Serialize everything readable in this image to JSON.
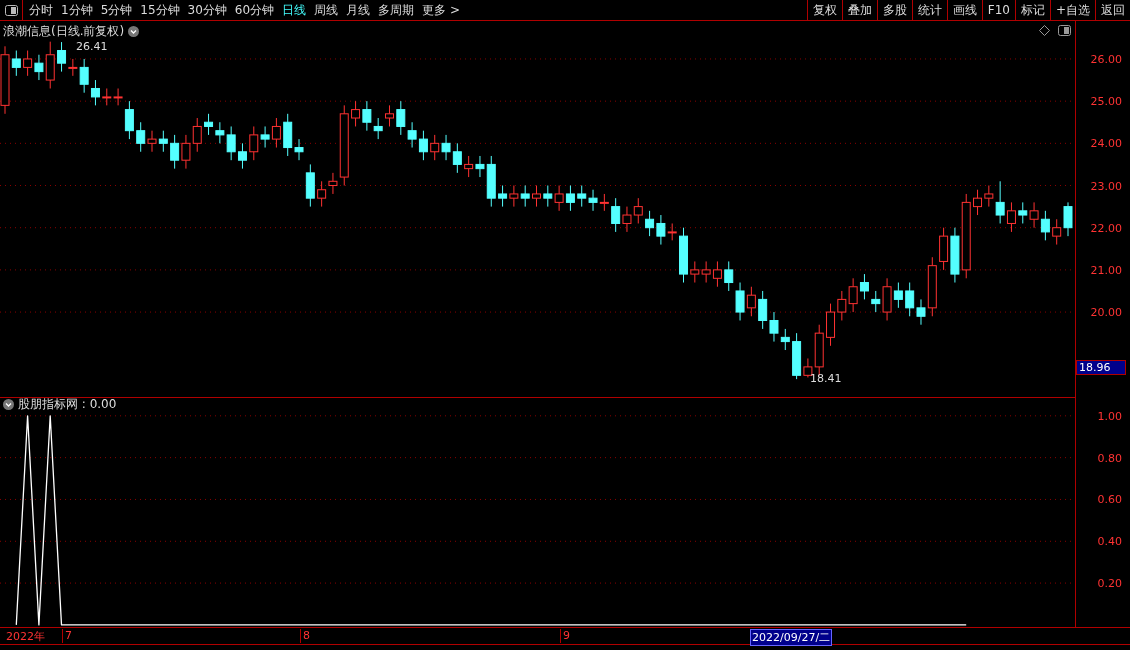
{
  "toolbar": {
    "periods": [
      {
        "label": "分时",
        "selected": false
      },
      {
        "label": "1分钟",
        "selected": false
      },
      {
        "label": "5分钟",
        "selected": false
      },
      {
        "label": "15分钟",
        "selected": false
      },
      {
        "label": "30分钟",
        "selected": false
      },
      {
        "label": "60分钟",
        "selected": false
      },
      {
        "label": "日线",
        "selected": true
      },
      {
        "label": "周线",
        "selected": false
      },
      {
        "label": "月线",
        "selected": false
      },
      {
        "label": "多周期",
        "selected": false
      },
      {
        "label": "更多 >",
        "selected": false
      }
    ],
    "actions": [
      "复权",
      "叠加",
      "多股",
      "统计",
      "画线",
      "F10",
      "标记",
      "+自选",
      "返回"
    ]
  },
  "price_panel": {
    "title": "浪潮信息(日线.前复权)",
    "high_label": "26.41",
    "low_label": "18.41",
    "current_price": "18.96",
    "chart_data": {
      "type": "candlestick",
      "ylim": [
        18.01,
        26.9
      ],
      "grid": true,
      "yticks": [
        {
          "value": 26,
          "label": "26.00"
        },
        {
          "value": 25,
          "label": "25.00"
        },
        {
          "value": 24,
          "label": "24.00"
        },
        {
          "value": 23,
          "label": "23.00"
        },
        {
          "value": 22,
          "label": "22.00"
        },
        {
          "value": 21,
          "label": "21.00"
        },
        {
          "value": 20,
          "label": "20.00"
        }
      ],
      "ohlc": [
        [
          24.9,
          26.3,
          24.7,
          26.1
        ],
        [
          26,
          26.2,
          25.6,
          25.8
        ],
        [
          25.8,
          26.2,
          25.6,
          26
        ],
        [
          25.9,
          26.1,
          25.5,
          25.7
        ],
        [
          25.5,
          26.41,
          25.3,
          26.1
        ],
        [
          26.2,
          26.4,
          25.7,
          25.9
        ],
        [
          25.8,
          26,
          25.6,
          25.8
        ],
        [
          25.8,
          26,
          25.2,
          25.4
        ],
        [
          25.3,
          25.5,
          24.9,
          25.1
        ],
        [
          25.1,
          25.3,
          24.9,
          25.1
        ],
        [
          25.1,
          25.3,
          24.9,
          25.1
        ],
        [
          24.8,
          25,
          24.1,
          24.3
        ],
        [
          24.3,
          24.5,
          23.8,
          24
        ],
        [
          24,
          24.3,
          23.8,
          24.1
        ],
        [
          24.1,
          24.3,
          23.8,
          24
        ],
        [
          24,
          24.2,
          23.4,
          23.6
        ],
        [
          23.6,
          24.2,
          23.4,
          24
        ],
        [
          24,
          24.6,
          23.8,
          24.4
        ],
        [
          24.5,
          24.7,
          24.2,
          24.4
        ],
        [
          24.3,
          24.5,
          24,
          24.2
        ],
        [
          24.2,
          24.4,
          23.6,
          23.8
        ],
        [
          23.8,
          24,
          23.4,
          23.6
        ],
        [
          23.8,
          24.4,
          23.6,
          24.2
        ],
        [
          24.2,
          24.4,
          23.9,
          24.1
        ],
        [
          24.1,
          24.6,
          23.9,
          24.4
        ],
        [
          24.5,
          24.7,
          23.7,
          23.9
        ],
        [
          23.9,
          24.1,
          23.6,
          23.8
        ],
        [
          23.3,
          23.5,
          22.5,
          22.7
        ],
        [
          22.7,
          23.1,
          22.5,
          22.9
        ],
        [
          23,
          23.3,
          22.8,
          23.1
        ],
        [
          23.2,
          24.9,
          23,
          24.7
        ],
        [
          24.6,
          25,
          24.4,
          24.8
        ],
        [
          24.8,
          25,
          24.3,
          24.5
        ],
        [
          24.4,
          24.6,
          24.1,
          24.3
        ],
        [
          24.6,
          24.9,
          24.4,
          24.7
        ],
        [
          24.8,
          25,
          24.2,
          24.4
        ],
        [
          24.3,
          24.5,
          23.9,
          24.1
        ],
        [
          24.1,
          24.3,
          23.6,
          23.8
        ],
        [
          23.8,
          24.2,
          23.6,
          24
        ],
        [
          24,
          24.2,
          23.6,
          23.8
        ],
        [
          23.8,
          24,
          23.3,
          23.5
        ],
        [
          23.4,
          23.7,
          23.2,
          23.5
        ],
        [
          23.5,
          23.7,
          23.2,
          23.4
        ],
        [
          23.5,
          23.7,
          22.5,
          22.7
        ],
        [
          22.8,
          23,
          22.5,
          22.7
        ],
        [
          22.7,
          23,
          22.5,
          22.8
        ],
        [
          22.8,
          23,
          22.5,
          22.7
        ],
        [
          22.7,
          23,
          22.5,
          22.8
        ],
        [
          22.8,
          23,
          22.5,
          22.7
        ],
        [
          22.6,
          23,
          22.4,
          22.8
        ],
        [
          22.8,
          23,
          22.4,
          22.6
        ],
        [
          22.8,
          23,
          22.5,
          22.7
        ],
        [
          22.7,
          22.9,
          22.4,
          22.6
        ],
        [
          22.6,
          22.8,
          22.4,
          22.6
        ],
        [
          22.5,
          22.7,
          21.9,
          22.1
        ],
        [
          22.1,
          22.5,
          21.9,
          22.3
        ],
        [
          22.3,
          22.7,
          22.1,
          22.5
        ],
        [
          22.2,
          22.4,
          21.8,
          22
        ],
        [
          22.1,
          22.3,
          21.6,
          21.8
        ],
        [
          21.9,
          22.1,
          21.7,
          21.9
        ],
        [
          21.8,
          22,
          20.7,
          20.9
        ],
        [
          20.9,
          21.2,
          20.7,
          21
        ],
        [
          20.9,
          21.2,
          20.7,
          21
        ],
        [
          20.8,
          21.2,
          20.6,
          21
        ],
        [
          21,
          21.2,
          20.5,
          20.7
        ],
        [
          20.5,
          20.7,
          19.8,
          20
        ],
        [
          20.1,
          20.6,
          19.9,
          20.4
        ],
        [
          20.3,
          20.5,
          19.6,
          19.8
        ],
        [
          19.8,
          20,
          19.3,
          19.5
        ],
        [
          19.4,
          19.6,
          19.1,
          19.3
        ],
        [
          19.3,
          19.5,
          18.41,
          18.5
        ],
        [
          18.5,
          18.9,
          18.45,
          18.7
        ],
        [
          18.7,
          19.7,
          18.5,
          19.5
        ],
        [
          19.4,
          20.2,
          19.2,
          20
        ],
        [
          20,
          20.5,
          19.8,
          20.3
        ],
        [
          20.2,
          20.8,
          20,
          20.6
        ],
        [
          20.7,
          20.9,
          20.3,
          20.5
        ],
        [
          20.3,
          20.5,
          20,
          20.2
        ],
        [
          20,
          20.8,
          19.8,
          20.6
        ],
        [
          20.5,
          20.7,
          20.1,
          20.3
        ],
        [
          20.5,
          20.7,
          19.9,
          20.1
        ],
        [
          20.1,
          20.3,
          19.7,
          19.9
        ],
        [
          20.1,
          21.3,
          19.9,
          21.1
        ],
        [
          21.2,
          22,
          21,
          21.8
        ],
        [
          21.8,
          22,
          20.7,
          20.9
        ],
        [
          21,
          22.8,
          20.8,
          22.6
        ],
        [
          22.5,
          22.9,
          22.3,
          22.7
        ],
        [
          22.7,
          23,
          22.5,
          22.8
        ],
        [
          22.6,
          23.1,
          22.1,
          22.3
        ],
        [
          22.1,
          22.6,
          21.9,
          22.4
        ],
        [
          22.4,
          22.6,
          22.1,
          22.3
        ],
        [
          22.2,
          22.6,
          22,
          22.4
        ],
        [
          22.2,
          22.4,
          21.7,
          21.9
        ],
        [
          21.8,
          22.2,
          21.6,
          22
        ],
        [
          22.5,
          22.6,
          21.8,
          22
        ]
      ]
    }
  },
  "indicator_panel": {
    "separator": ":",
    "value": "0.00",
    "chart_data": {
      "type": "line",
      "ylim": [
        -0.01,
        1.09
      ],
      "grid": true,
      "yticks": [
        {
          "value": 1,
          "label": "1.00"
        },
        {
          "value": 0.8,
          "label": "0.80"
        },
        {
          "value": 0.6,
          "label": "0.60"
        },
        {
          "value": 0.4,
          "label": "0.40"
        },
        {
          "value": 0.2,
          "label": "0.20"
        }
      ],
      "series": [
        {
          "name": "股朋指标网",
          "color": "#ffffff",
          "values": [
            null,
            0,
            1,
            0,
            1,
            0,
            0,
            0,
            0,
            0,
            0,
            0,
            0,
            0,
            0,
            0,
            0,
            0,
            0,
            0,
            0,
            0,
            0,
            0,
            0,
            0,
            0,
            0,
            0,
            0,
            0,
            0,
            0,
            0,
            0,
            0,
            0,
            0,
            0,
            0,
            0,
            0,
            0,
            0,
            0,
            0,
            0,
            0,
            0,
            0,
            0,
            0,
            0,
            0,
            0,
            0,
            0,
            0,
            0,
            0,
            0,
            0,
            0,
            0,
            0,
            0,
            0,
            0,
            0,
            0,
            0,
            0,
            0,
            0,
            0,
            0,
            0,
            0,
            0,
            0,
            0,
            0,
            0,
            0,
            0,
            0
          ]
        }
      ]
    }
  },
  "date_axis": {
    "labels": [
      {
        "text": "2022年",
        "kind": "year"
      },
      {
        "text": "7",
        "kind": "month"
      },
      {
        "text": "8",
        "kind": "month"
      },
      {
        "text": "9",
        "kind": "month"
      }
    ],
    "cursor_date": "2022/09/27/二"
  }
}
